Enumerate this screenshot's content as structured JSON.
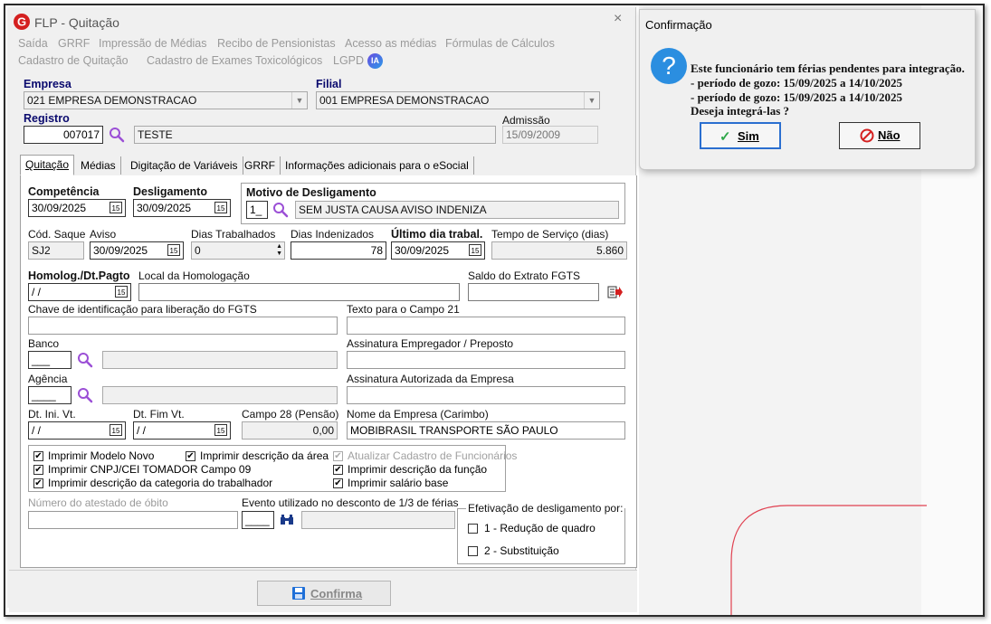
{
  "window": {
    "title": "FLP - Quitação",
    "close": "×"
  },
  "menu": {
    "row1": [
      "Saída",
      "GRRF",
      "Impressão de Médias",
      "Recibo de Pensionistas",
      "Acesso as médias",
      "Fórmulas de Cálculos"
    ],
    "row2": [
      "Cadastro de Quitação",
      "Cadastro de Exames Toxicológicos",
      "LGPD"
    ],
    "ia_badge": "IA"
  },
  "empresa": {
    "label": "Empresa",
    "value": "021 EMPRESA DEMONSTRACAO"
  },
  "filial": {
    "label": "Filial",
    "value": "001 EMPRESA DEMONSTRACAO"
  },
  "registro": {
    "label": "Registro",
    "code": "007017",
    "name": "TESTE"
  },
  "admissao": {
    "label": "Admissão",
    "value": "15/09/2009"
  },
  "tabs": [
    "Quitação",
    "Médias",
    "Digitação de Variáveis",
    "GRRF",
    "Informações adicionais para o eSocial"
  ],
  "calendar_glyph": "15",
  "competencia": {
    "label": "Competência",
    "value": "30/09/2025"
  },
  "desligamento": {
    "label": "Desligamento",
    "value": "30/09/2025"
  },
  "motivo": {
    "label": "Motivo de Desligamento",
    "code": "1_",
    "desc": "SEM JUSTA CAUSA AVISO INDENIZA"
  },
  "cod_saque": {
    "label": "Cód. Saque",
    "value": "SJ2"
  },
  "aviso": {
    "label": "Aviso",
    "value": "30/09/2025"
  },
  "dias_trabalhados": {
    "label": "Dias Trabalhados",
    "value": "0"
  },
  "dias_indenizados": {
    "label": "Dias Indenizados",
    "value": "78"
  },
  "ultimo_dia": {
    "label": "Último dia trabal.",
    "value": "30/09/2025"
  },
  "tempo_servico": {
    "label": "Tempo de Serviço (dias)",
    "value": "5.860"
  },
  "homolog": {
    "label": "Homolog./Dt.Pagto",
    "value": " / /"
  },
  "local_homolog": {
    "label": "Local da Homologação",
    "value": ""
  },
  "saldo_fgts": {
    "label": "Saldo do Extrato FGTS",
    "value": ""
  },
  "chave_fgts": {
    "label": "Chave de identificação para liberação do FGTS",
    "value": ""
  },
  "texto_campo21": {
    "label": "Texto para o Campo 21",
    "value": ""
  },
  "banco": {
    "label": "Banco",
    "value": "___"
  },
  "assinatura_empregador": {
    "label": "Assinatura Empregador / Preposto",
    "value": ""
  },
  "agencia": {
    "label": "Agência",
    "value": "____"
  },
  "assinatura_autorizada": {
    "label": "Assinatura Autorizada da Empresa",
    "value": ""
  },
  "dt_ini_vt": {
    "label": "Dt. Ini. Vt.",
    "value": " / /"
  },
  "dt_fim_vt": {
    "label": "Dt. Fim Vt.",
    "value": " / /"
  },
  "campo28": {
    "label": "Campo 28 (Pensão)",
    "value": "0,00"
  },
  "nome_empresa": {
    "label": "Nome da Empresa (Carimbo)",
    "value": "MOBIBRASIL TRANSPORTE SÃO PAULO"
  },
  "checkboxes": [
    {
      "label": "Imprimir Modelo Novo",
      "checked": true,
      "enabled": true
    },
    {
      "label": "Imprimir descrição da área",
      "checked": true,
      "enabled": true
    },
    {
      "label": "Atualizar Cadastro de Funcionários",
      "checked": true,
      "enabled": false
    },
    {
      "label": "Imprimir CNPJ/CEI TOMADOR Campo 09",
      "checked": true,
      "enabled": true
    },
    {
      "label": "Imprimir descrição da função",
      "checked": true,
      "enabled": true
    },
    {
      "label": "Imprimir descrição da categoria do trabalhador",
      "checked": true,
      "enabled": true
    },
    {
      "label": "Imprimir salário base",
      "checked": true,
      "enabled": true
    }
  ],
  "checkmark": "✔",
  "atestado_obito": {
    "label": "Número do atestado de óbito",
    "value": ""
  },
  "evento_desconto": {
    "label": "Evento utilizado no desconto de 1/3 de férias",
    "value": "____"
  },
  "efetivacao": {
    "label": "Efetivação de desligamento por:",
    "options": [
      "1 - Redução de quadro",
      "2 - Substituição"
    ]
  },
  "confirma_button": "Confirma",
  "dialog": {
    "title": "Confirmação",
    "icon": "?",
    "lines": [
      "Este funcionário tem férias pendentes para integração.",
      "- período de gozo: 15/09/2025 a 14/10/2025",
      "- período de gozo: 15/09/2025 a 14/10/2025",
      "Deseja integrá-las ?"
    ],
    "yes_label": "Sim",
    "no_label": "Não"
  },
  "colors": {
    "accent_blue": "#1e6fd8",
    "label_navy": "#0a0a6e",
    "red": "#d42020",
    "purple": "#8a3fc7"
  }
}
